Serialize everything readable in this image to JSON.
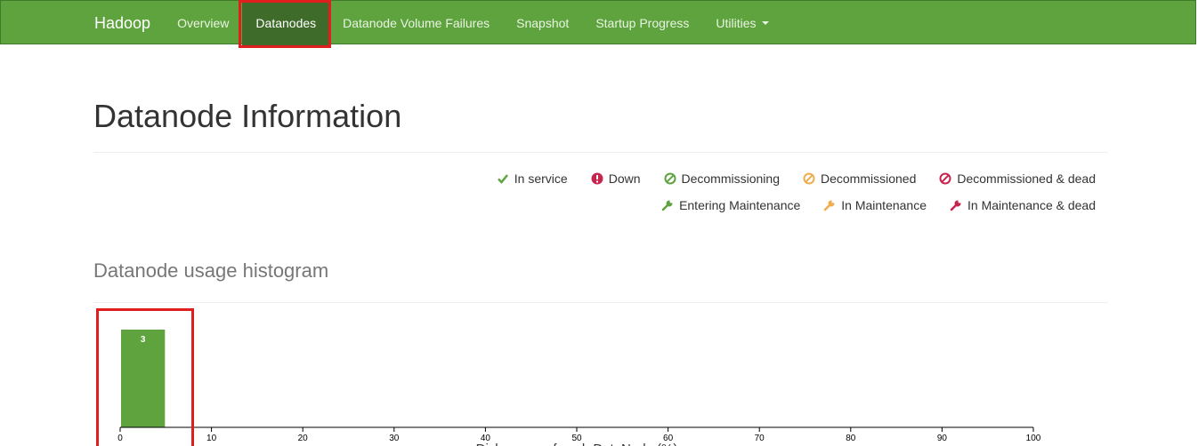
{
  "navbar": {
    "brand": "Hadoop",
    "items": [
      {
        "label": "Overview"
      },
      {
        "label": "Datanodes"
      },
      {
        "label": "Datanode Volume Failures"
      },
      {
        "label": "Snapshot"
      },
      {
        "label": "Startup Progress"
      },
      {
        "label": "Utilities"
      }
    ],
    "active": "Datanodes"
  },
  "page": {
    "title": "Datanode Information",
    "histogram_title": "Datanode usage histogram"
  },
  "legend": {
    "row1": [
      {
        "label": "In service",
        "icon": "checkmark-icon",
        "color": "#5fa33e"
      },
      {
        "label": "Down",
        "icon": "exclamation-circle-icon",
        "color": "#c7254e"
      },
      {
        "label": "Decommissioning",
        "icon": "ban-icon",
        "color": "#5fa33e"
      },
      {
        "label": "Decommissioned",
        "icon": "ban-icon",
        "color": "#f0ad4e"
      },
      {
        "label": "Decommissioned & dead",
        "icon": "ban-icon",
        "color": "#c7254e"
      }
    ],
    "row2": [
      {
        "label": "Entering Maintenance",
        "icon": "wrench-icon",
        "color": "#5fa33e"
      },
      {
        "label": "In Maintenance",
        "icon": "wrench-icon",
        "color": "#f0ad4e"
      },
      {
        "label": "In Maintenance & dead",
        "icon": "wrench-icon",
        "color": "#c7254e"
      }
    ]
  },
  "colors": {
    "navbar": "#5fa33e",
    "nav_active": "#3f6b2a",
    "bar": "#5fa33e",
    "highlight": "#e01e1e"
  },
  "chart_data": {
    "type": "bar",
    "title": "Datanode usage histogram",
    "xlabel": "Disk usage of each DataNode (%)",
    "xlim": [
      0,
      100
    ],
    "x_ticks": [
      0,
      10,
      20,
      30,
      40,
      50,
      60,
      70,
      80,
      90,
      100
    ],
    "bins": [
      {
        "x0": 0,
        "x1": 5,
        "count": 3
      }
    ],
    "bar_labels": [
      "3"
    ]
  }
}
